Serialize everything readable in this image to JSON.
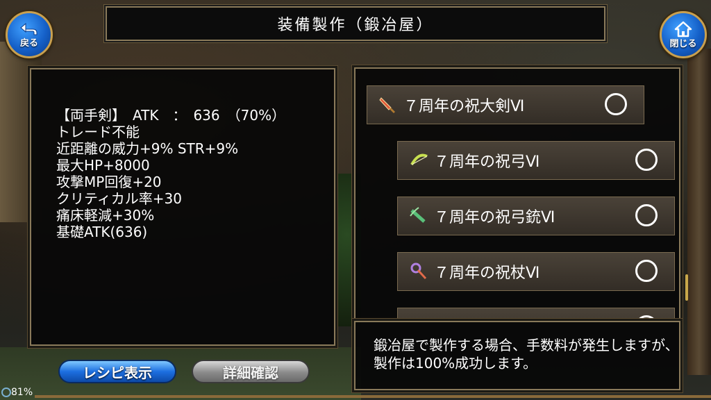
{
  "header": {
    "title": "装備製作（鍛冶屋）"
  },
  "nav": {
    "back_label": "戻る",
    "close_label": "閉じる"
  },
  "stats": {
    "lines": [
      "【両手剣】　ATK　：　636　（70%）",
      "トレード不能",
      "近距離の威力+9% STR+9%",
      "最大HP+8000",
      "攻撃MP回復+20",
      "クリティカル率+30",
      "痛床軽減+30%",
      "基礎ATK(636)"
    ]
  },
  "recipe_list": {
    "items": [
      {
        "name": "７周年の祝大剣Ⅵ",
        "icon": "greatsword-icon",
        "selected": false
      },
      {
        "name": "７周年の祝弓Ⅵ",
        "icon": "bow-icon",
        "selected": false
      },
      {
        "name": "７周年の祝弓銃Ⅵ",
        "icon": "crossbow-icon",
        "selected": false
      },
      {
        "name": "７周年の祝杖Ⅵ",
        "icon": "staff-icon",
        "selected": false
      }
    ]
  },
  "message": {
    "text": "鍛冶屋で製作する場合、手数料が発生しますが、製作は100%成功します。"
  },
  "buttons": {
    "recipe_label": "レシピ表示",
    "detail_label": "詳細確認"
  },
  "status": {
    "battery": "81%"
  },
  "colors": {
    "accent_blue": "#1d6fe0",
    "frame_gold": "#8a7a5a",
    "panel_bg": "#080808"
  }
}
